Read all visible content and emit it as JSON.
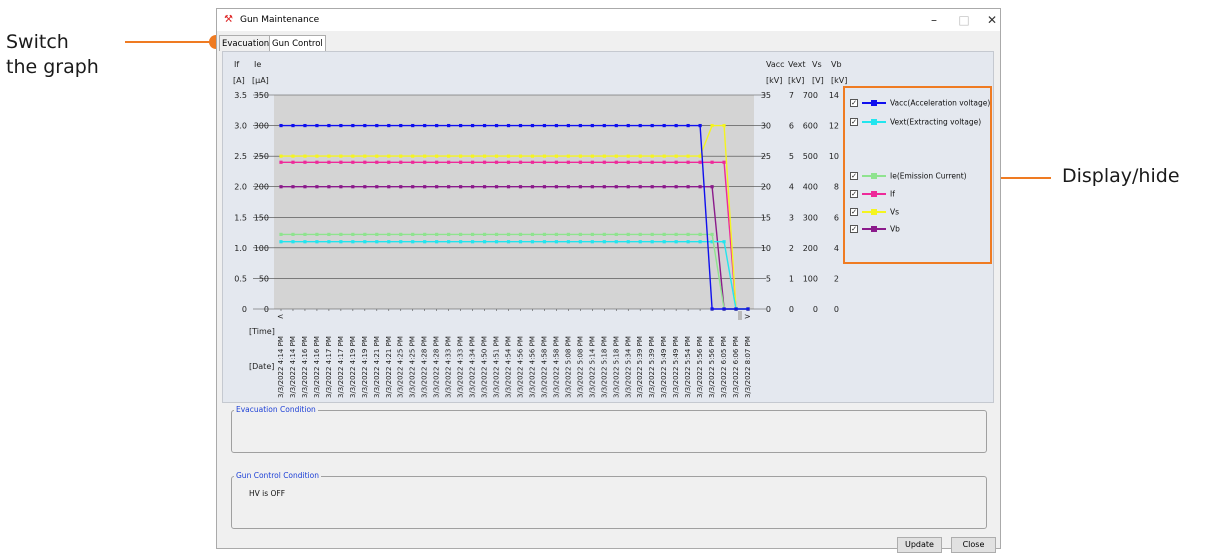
{
  "annotations": {
    "switch_line1": "Switch",
    "switch_line2": "the graph",
    "display_hide": "Display/hide"
  },
  "window": {
    "title": "Gun Maintenance",
    "minimize": "–",
    "maximize": "□",
    "close": "✕"
  },
  "tabs": [
    {
      "label": "Evacuation"
    },
    {
      "label": "Gun Control"
    }
  ],
  "axis_headers": {
    "left": [
      "If",
      "Ie"
    ],
    "left_units": [
      "[A]",
      "[μA]"
    ],
    "right": [
      "Vacc",
      "Vext",
      "Vs",
      "Vb"
    ],
    "right_units": [
      "[kV]",
      "[kV]",
      "[V]",
      "[kV]"
    ],
    "time_label": "[Time]",
    "date_label": "[Date]"
  },
  "chart_data": {
    "type": "line",
    "left_axes": {
      "If": [
        "3.5",
        "3.0",
        "2.5",
        "2.0",
        "1.5",
        "1.0",
        "0.5",
        "0"
      ],
      "Ie": [
        "350",
        "300",
        "250",
        "200",
        "150",
        "100",
        "50",
        "0"
      ]
    },
    "right_axes": {
      "Vacc": [
        "35",
        "30",
        "25",
        "20",
        "15",
        "10",
        "5",
        "0"
      ],
      "Vext": [
        "7",
        "6",
        "5",
        "4",
        "3",
        "2",
        "1",
        "0"
      ],
      "Vs": [
        "700",
        "600",
        "500",
        "400",
        "300",
        "200",
        "100",
        "0"
      ],
      "Vb": [
        "14",
        "12",
        "10",
        "8",
        "6",
        "4",
        "2",
        "0"
      ]
    },
    "ylim_If": [
      0,
      3.5
    ],
    "x_labels": [
      "3/3/2022 4:14 PM",
      "3/3/2022 4:14 PM",
      "3/3/2022 4:16 PM",
      "3/3/2022 4:16 PM",
      "3/3/2022 4:17 PM",
      "3/3/2022 4:17 PM",
      "3/3/2022 4:19 PM",
      "3/3/2022 4:19 PM",
      "3/3/2022 4:21 PM",
      "3/3/2022 4:21 PM",
      "3/3/2022 4:25 PM",
      "3/3/2022 4:25 PM",
      "3/3/2022 4:28 PM",
      "3/3/2022 4:28 PM",
      "3/3/2022 4:33 PM",
      "3/3/2022 4:33 PM",
      "3/3/2022 4:34 PM",
      "3/3/2022 4:50 PM",
      "3/3/2022 4:51 PM",
      "3/3/2022 4:54 PM",
      "3/3/2022 4:56 PM",
      "3/3/2022 4:56 PM",
      "3/3/2022 4:58 PM",
      "3/3/2022 4:58 PM",
      "3/3/2022 5:08 PM",
      "3/3/2022 5:08 PM",
      "3/3/2022 5:14 PM",
      "3/3/2022 5:18 PM",
      "3/3/2022 5:18 PM",
      "3/3/2022 5:34 PM",
      "3/3/2022 5:39 PM",
      "3/3/2022 5:39 PM",
      "3/3/2022 5:49 PM",
      "3/3/2022 5:49 PM",
      "3/3/2022 5:54 PM",
      "3/3/2022 5:56 PM",
      "3/3/2022 5:56 PM",
      "3/3/2022 6:05 PM",
      "3/3/2022 6:06 PM",
      "3/3/2022 8:07 PM"
    ],
    "series": [
      {
        "name": "Vacc(Acceleration voltage)",
        "color": "#1010ee",
        "values": [
          30,
          30,
          30,
          30,
          30,
          30,
          30,
          30,
          30,
          30,
          30,
          30,
          30,
          30,
          30,
          30,
          30,
          30,
          30,
          30,
          30,
          30,
          30,
          30,
          30,
          30,
          30,
          30,
          30,
          30,
          30,
          30,
          30,
          30,
          30,
          30,
          0,
          0,
          0,
          0
        ]
      },
      {
        "name": "Vext(Extracting voltage)",
        "color": "#22e5ee",
        "values": [
          2.2,
          2.2,
          2.2,
          2.2,
          2.2,
          2.2,
          2.2,
          2.2,
          2.2,
          2.2,
          2.2,
          2.2,
          2.2,
          2.2,
          2.2,
          2.2,
          2.2,
          2.2,
          2.2,
          2.2,
          2.2,
          2.2,
          2.2,
          2.2,
          2.2,
          2.2,
          2.2,
          2.2,
          2.2,
          2.2,
          2.2,
          2.2,
          2.2,
          2.2,
          2.2,
          2.2,
          2.2,
          2.2,
          0,
          0
        ]
      },
      {
        "name": "Ie(Emission Current)",
        "color": "#8fe38f",
        "values": [
          122,
          122,
          122,
          122,
          122,
          122,
          122,
          122,
          122,
          122,
          122,
          122,
          122,
          122,
          122,
          122,
          122,
          122,
          122,
          122,
          122,
          122,
          122,
          122,
          122,
          122,
          122,
          122,
          122,
          122,
          122,
          122,
          122,
          122,
          122,
          122,
          122,
          0,
          0,
          0
        ]
      },
      {
        "name": "If",
        "color": "#ee2a9a",
        "values": [
          2.4,
          2.4,
          2.4,
          2.4,
          2.4,
          2.4,
          2.4,
          2.4,
          2.4,
          2.4,
          2.4,
          2.4,
          2.4,
          2.4,
          2.4,
          2.4,
          2.4,
          2.4,
          2.4,
          2.4,
          2.4,
          2.4,
          2.4,
          2.4,
          2.4,
          2.4,
          2.4,
          2.4,
          2.4,
          2.4,
          2.4,
          2.4,
          2.4,
          2.4,
          2.4,
          2.4,
          2.4,
          2.4,
          0,
          0
        ]
      },
      {
        "name": "Vs",
        "color": "#f4f420",
        "values": [
          500,
          500,
          500,
          500,
          500,
          500,
          500,
          500,
          500,
          500,
          500,
          500,
          500,
          500,
          500,
          500,
          500,
          500,
          500,
          500,
          500,
          500,
          500,
          500,
          500,
          500,
          500,
          500,
          500,
          500,
          500,
          500,
          500,
          500,
          500,
          500,
          600,
          600,
          0,
          0
        ]
      },
      {
        "name": "Vb",
        "color": "#8b1a8b",
        "values": [
          8,
          8,
          8,
          8,
          8,
          8,
          8,
          8,
          8,
          8,
          8,
          8,
          8,
          8,
          8,
          8,
          8,
          8,
          8,
          8,
          8,
          8,
          8,
          8,
          8,
          8,
          8,
          8,
          8,
          8,
          8,
          8,
          8,
          8,
          8,
          8,
          8,
          0,
          0,
          0
        ]
      }
    ],
    "plot_background": "#d4d4d4"
  },
  "legend": [
    {
      "label": "Vacc(Acceleration voltage)",
      "color": "#1010ee",
      "checked": "✓"
    },
    {
      "label": "Vext(Extracting voltage)",
      "color": "#22e5ee",
      "checked": "✓"
    },
    {
      "label": "Ie(Emission Current)",
      "color": "#8fe38f",
      "checked": "✓"
    },
    {
      "label": "If",
      "color": "#ee2a9a",
      "checked": "✓"
    },
    {
      "label": "Vs",
      "color": "#f4f420",
      "checked": "✓"
    },
    {
      "label": "Vb",
      "color": "#8b1a8b",
      "checked": "✓"
    }
  ],
  "evacuation_condition": {
    "title": "Evacuation Condition",
    "text": ""
  },
  "gun_control_condition": {
    "title": "Gun Control Condition",
    "text": "HV is OFF"
  },
  "buttons": {
    "update": "Update",
    "close": "Close"
  },
  "scroll": {
    "left_arrow": "<",
    "right_arrow": ">"
  }
}
